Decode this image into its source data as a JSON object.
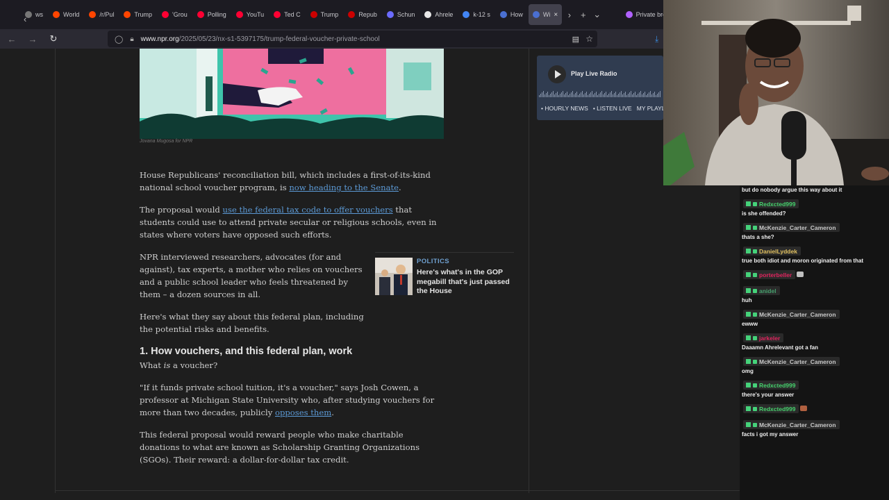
{
  "browser": {
    "tabs": [
      {
        "label": "ws",
        "color": "#777777"
      },
      {
        "label": "World",
        "color": "#ff4500"
      },
      {
        "label": "/r/Pul",
        "color": "#ff4500"
      },
      {
        "label": "Trump",
        "color": "#ff4500"
      },
      {
        "label": "'Grou",
        "color": "#ff0033"
      },
      {
        "label": "Polling",
        "color": "#ff0033"
      },
      {
        "label": "YouTu",
        "color": "#ff0033"
      },
      {
        "label": "Ted C",
        "color": "#ff0033"
      },
      {
        "label": "Trump",
        "color": "#cc0000"
      },
      {
        "label": "Repub",
        "color": "#cc0000"
      },
      {
        "label": "Schun",
        "color": "#6b6bff"
      },
      {
        "label": "Ahrele",
        "color": "#e8e8e8"
      },
      {
        "label": "k-12 s",
        "color": "#4285f4"
      },
      {
        "label": "How",
        "color": "#4a6fd1"
      },
      {
        "label": "Wi",
        "color": "#4a6fd1"
      }
    ],
    "private_label": "Private browsi",
    "url_domain": "www.npr.org",
    "url_path": "/2025/05/23/nx-s1-5397175/trump-federal-voucher-private-school"
  },
  "article": {
    "photo_credit": "Jovana Mugosa for NPR",
    "p1_before": "House Republicans' reconciliation bill, which includes a first-of-its-kind national school voucher program, is ",
    "p1_link": "now heading to the Senate",
    "p1_after": ".",
    "p2_before": "The proposal would ",
    "p2_link": "use the federal tax code to offer vouchers",
    "p2_after": " that students could use to attend private secular or religious schools, even in states where voters have opposed such efforts.",
    "p3": "NPR interviewed researchers, advocates (for and against), tax experts, a mother who relies on vouchers and a public school leader who feels threatened by them – a dozen sources in all.",
    "p4": "Here's what they say about this federal plan, including the potential risks and benefits.",
    "h2": "1. How vouchers, and this federal plan, work",
    "sub_before": "What ",
    "sub_em": "is",
    "sub_after": " a voucher?",
    "p5_before": "\"If it funds private school tuition, it's a voucher,\" says Josh Cowen, a professor at Michigan State University who, after studying vouchers for more than two decades, publicly ",
    "p5_link": "opposes them",
    "p5_after": ".",
    "p6": "This federal proposal would reward people who make charitable donations to what are known as Scholarship Granting Organizations (SGOs). Their reward: a dollar-for-dollar tax credit."
  },
  "related": {
    "kicker": "POLITICS",
    "headline": "Here's what's in the GOP megabill that's just passed the House"
  },
  "radio": {
    "play_label": "Play Live Radio",
    "links": [
      "• HOURLY NEWS",
      "• LISTEN LIVE",
      "MY PLAYL"
    ]
  },
  "chat": [
    {
      "user": "",
      "text": "but do nobody argue this way about it"
    },
    {
      "user": "Redxcted999",
      "color": "#46d16d",
      "text": "is she offended?"
    },
    {
      "user": "McKenzie_Carter_Cameron",
      "color": "#c9c9c9",
      "text": "thats a she?"
    },
    {
      "user": "DanielLyddek",
      "color": "#e0c060",
      "text": "true both idiot and moron originated from that"
    },
    {
      "user": "porterbeller",
      "color": "#e0245e",
      "text": "",
      "emote": "#c0c0c0"
    },
    {
      "user": "anidel",
      "color": "#46a06d",
      "text": "huh"
    },
    {
      "user": "McKenzie_Carter_Cameron",
      "color": "#c9c9c9",
      "text": "ewww"
    },
    {
      "user": "jarkeler",
      "color": "#e0245e",
      "text": "Daaamn Ahrelevant got a fan"
    },
    {
      "user": "McKenzie_Carter_Cameron",
      "color": "#c9c9c9",
      "text": "omg"
    },
    {
      "user": "Redxcted999",
      "color": "#46d16d",
      "text": "there's your answer"
    },
    {
      "user": "Redxcted999",
      "color": "#46d16d",
      "text": "",
      "emote": "#b06040"
    },
    {
      "user": "McKenzie_Carter_Cameron",
      "color": "#c9c9c9",
      "text": "facts i got my answer"
    }
  ]
}
